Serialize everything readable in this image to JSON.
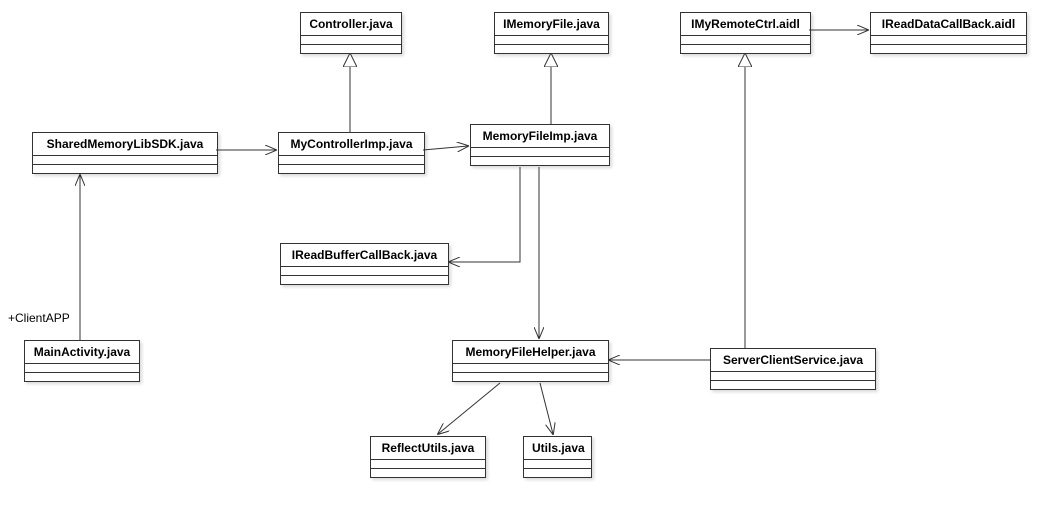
{
  "classes": {
    "controller": {
      "title": "Controller.java"
    },
    "imemoryfile": {
      "title": "IMemoryFile.java"
    },
    "imyremotectrl": {
      "title": "IMyRemoteCtrl.aidl"
    },
    "ireaddatacallback": {
      "title": "IReadDataCallBack.aidl"
    },
    "sharedmemory": {
      "title": "SharedMemoryLibSDK.java"
    },
    "mycontrollerimp": {
      "title": "MyControllerImp.java"
    },
    "memoryfileimp": {
      "title": "MemoryFileImp.java"
    },
    "ireadbuffercallback": {
      "title": "IReadBufferCallBack.java"
    },
    "mainactivity": {
      "title": "MainActivity.java"
    },
    "memoryfilehelper": {
      "title": "MemoryFileHelper.java"
    },
    "serverclientservice": {
      "title": "ServerClientService.java"
    },
    "reflectutils": {
      "title": "ReflectUtils.java"
    },
    "utils": {
      "title": "Utils.java"
    }
  },
  "notes": {
    "clientapp": "+ClientAPP"
  }
}
